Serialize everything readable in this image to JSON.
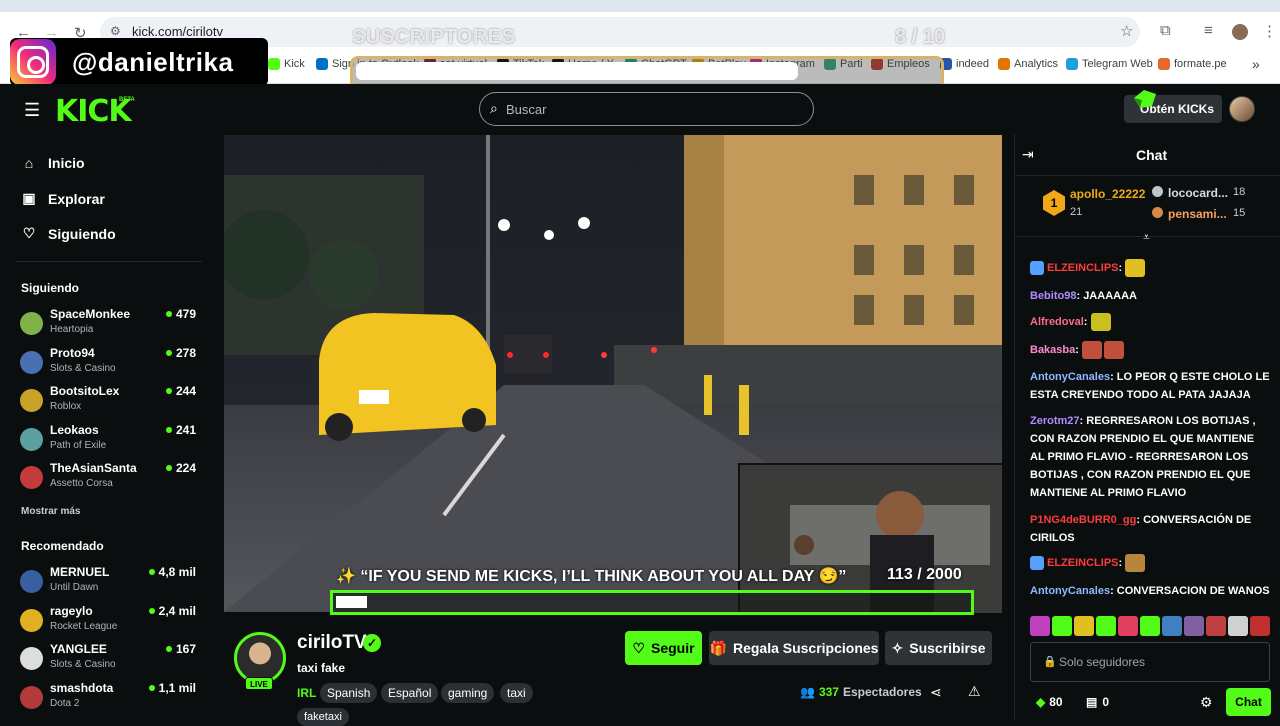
{
  "browser": {
    "url": "kick.com/cirilotv",
    "bookmarks": [
      "Kick",
      "Sign in to Outlook",
      "sat virtual",
      "TikTok",
      "Home / X",
      "ChatGPT",
      "BetPlay",
      "Instagram",
      "Parti",
      "Empleos",
      "indeed",
      "Analytics",
      "Telegram Web",
      "formate.pe"
    ],
    "more_bookmarks": "»"
  },
  "overlay": {
    "instagram_handle": "@danieltrika",
    "subs_title": "SUSCRIPTORES",
    "subs_count": "8  / 10",
    "subs_progress": 0.8,
    "kicks_goal_text": "✨ “IF YOU SEND ME KICKS, I’LL THINK ABOUT YOU ALL DAY 😏”",
    "kicks_goal_count": "113  / 2000",
    "kicks_progress": 0.0565
  },
  "header": {
    "logo": "KICK",
    "beta": "BETA",
    "search_placeholder": "Buscar",
    "kicks_button": "Obtén KICKs"
  },
  "sidebar": {
    "nav": [
      {
        "label": "Inicio",
        "icon": "home-icon"
      },
      {
        "label": "Explorar",
        "icon": "browse-icon"
      },
      {
        "label": "Siguiendo",
        "icon": "heart-icon"
      }
    ],
    "following_title": "Siguiendo",
    "following": [
      {
        "name": "SpaceMonkee",
        "game": "Heartopia",
        "viewers": "479",
        "color": "#7fb34a"
      },
      {
        "name": "Proto94",
        "game": "Slots & Casino",
        "viewers": "278",
        "color": "#4a6fb3"
      },
      {
        "name": "BootsitoLex",
        "game": "Roblox",
        "viewers": "244",
        "color": "#c9a227"
      },
      {
        "name": "Leokaos",
        "game": "Path of Exile",
        "viewers": "241",
        "color": "#5aa0a0"
      },
      {
        "name": "TheAsianSanta",
        "game": "Assetto Corsa",
        "viewers": "224",
        "color": "#c43b3b"
      }
    ],
    "show_more": "Mostrar más",
    "recommended_title": "Recomendado",
    "recommended": [
      {
        "name": "MERNUEL",
        "game": "Until Dawn",
        "viewers": "4,8 mil",
        "color": "#3a5fa0"
      },
      {
        "name": "rageylo",
        "game": "Rocket League",
        "viewers": "2,4 mil",
        "color": "#e0b020"
      },
      {
        "name": "YANGLEE",
        "game": "Slots & Casino",
        "viewers": "167",
        "color": "#dddddd"
      },
      {
        "name": "smashdota",
        "game": "Dota 2",
        "viewers": "1,1 mil",
        "color": "#b33a3a"
      }
    ]
  },
  "channel": {
    "name": "ciriloTV",
    "live": "LIVE",
    "stream_title": "taxi fake",
    "category": "IRL",
    "tags": [
      "Spanish",
      "Español",
      "gaming",
      "taxi"
    ],
    "extra_tag": "faketaxi",
    "follow": "Seguir",
    "gift": "Regala Suscripciones",
    "subscribe": "Suscribirse",
    "viewers": "337",
    "viewers_label": "Espectadores"
  },
  "chat": {
    "title": "Chat",
    "top_gifters": [
      {
        "rank": "1",
        "name": "apollo_22222",
        "count": "21"
      },
      {
        "name": "lococard...",
        "count": "18"
      },
      {
        "name": "pensami...",
        "count": "15"
      }
    ],
    "messages": [
      {
        "user": "ELZEINCLIPS",
        "color": "#ff3b3b",
        "text": ":"
      },
      {
        "user": "Bebito98",
        "color": "#b18cff",
        "text": ": JAAAAAA"
      },
      {
        "user": "Alfredoval",
        "color": "#ff6b8a",
        "text": ":"
      },
      {
        "user": "Bakasba",
        "color": "#ff8ad0",
        "text": ":"
      },
      {
        "user": "AntonyCanales",
        "color": "#8fb8ff",
        "text": ": LO PEOR Q ESTE CHOLO LE ESTA CREYENDO TODO AL PATA JAJAJA"
      },
      {
        "user": "Zerotm27",
        "color": "#b18cff",
        "text": ": REGRRESARON LOS BOTIJAS , CON RAZON PRENDIO EL QUE MANTIENE AL PRIMO FLAVIO - REGRRESARON LOS BOTIJAS , CON RAZON PRENDIO EL QUE MANTIENE AL PRIMO FLAVIO"
      },
      {
        "user": "P1NG4deBURR0_gg",
        "color": "#ff3b3b",
        "text": ": CONVERSACIÓN DE CIRILOS"
      },
      {
        "user": "ELZEINCLIPS",
        "color": "#ff3b3b",
        "text": ":"
      },
      {
        "user": "AntonyCanales",
        "color": "#8fb8ff",
        "text": ": CONVERSACION DE WANOS"
      }
    ],
    "input_placeholder": "Solo seguidores",
    "kicks_balance": "80",
    "gift_balance": "0",
    "send": "Chat"
  }
}
